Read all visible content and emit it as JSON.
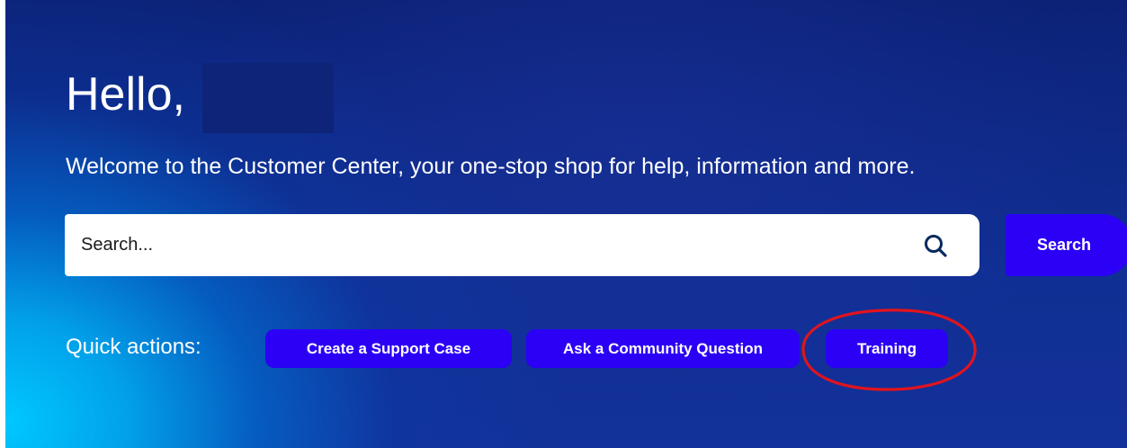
{
  "hero": {
    "greeting": "Hello,",
    "welcome_text": "Welcome to the Customer Center, your one-stop shop for help, information and more."
  },
  "search": {
    "placeholder": "Search...",
    "icon": "search-icon",
    "button_label": "Search"
  },
  "quick_actions": {
    "label": "Quick actions:",
    "buttons": [
      {
        "label": "Create a Support Case"
      },
      {
        "label": "Ask a Community Question"
      },
      {
        "label": "Training"
      }
    ]
  },
  "colors": {
    "button_accent": "#2b00f5",
    "hero_dark": "#0c2277",
    "hero_light": "#00c8ff",
    "annotation": "#e0141e"
  }
}
